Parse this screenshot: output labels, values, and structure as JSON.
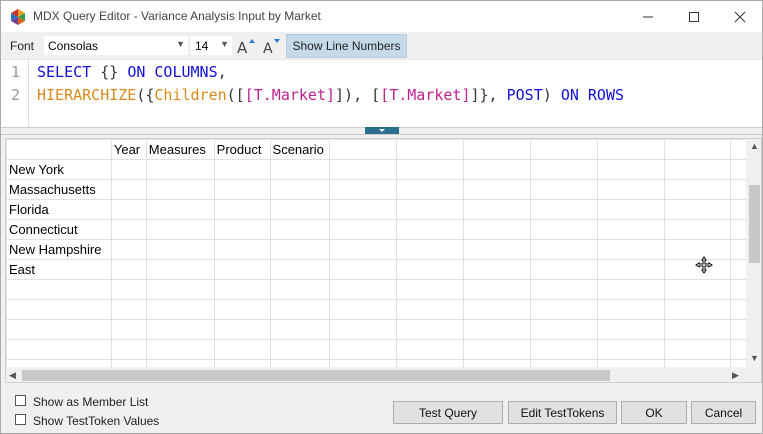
{
  "window": {
    "title": "MDX Query Editor - Variance Analysis Input by Market"
  },
  "toolbar": {
    "font_label": "Font",
    "font_value": "Consolas",
    "size_value": "14",
    "toggle_label": "Show Line Numbers"
  },
  "editor": {
    "line_numbers": [
      "1",
      "2"
    ],
    "lines": [
      [
        {
          "text": "SELECT ",
          "kind": "kw"
        },
        {
          "text": "{} ",
          "kind": "pl"
        },
        {
          "text": "ON COLUMNS",
          "kind": "kw"
        },
        {
          "text": ",",
          "kind": "pl"
        }
      ],
      [
        {
          "text": "HIERARCHIZE",
          "kind": "fn"
        },
        {
          "text": "({",
          "kind": "pl"
        },
        {
          "text": "Children",
          "kind": "fn"
        },
        {
          "text": "([",
          "kind": "pl"
        },
        {
          "text": "[T.Market]",
          "kind": "mb"
        },
        {
          "text": "]), [",
          "kind": "pl"
        },
        {
          "text": "[T.Market]",
          "kind": "mb"
        },
        {
          "text": "]}, ",
          "kind": "pl"
        },
        {
          "text": "POST",
          "kind": "kw"
        },
        {
          "text": ") ",
          "kind": "pl"
        },
        {
          "text": "ON ROWS",
          "kind": "kw"
        }
      ]
    ]
  },
  "grid": {
    "header": [
      "",
      "Year",
      "Measures",
      "Product",
      "Scenario"
    ],
    "rows": [
      "New York",
      "Massachusetts",
      "Florida",
      "Connecticut",
      "New Hampshire",
      "East"
    ],
    "empty_rows": 5
  },
  "options": {
    "show_member_list": "Show as Member List",
    "show_token_values": "Show TestToken Values"
  },
  "buttons": {
    "test_query": "Test Query",
    "edit_tokens": "Edit TestTokens",
    "ok": "OK",
    "cancel": "Cancel"
  },
  "colors": {
    "keyword": "#1010d8",
    "function": "#d98a1a",
    "member": "#c02090",
    "toggle_active": "#c5dae8",
    "splitter_handle": "#2a6f8f"
  }
}
